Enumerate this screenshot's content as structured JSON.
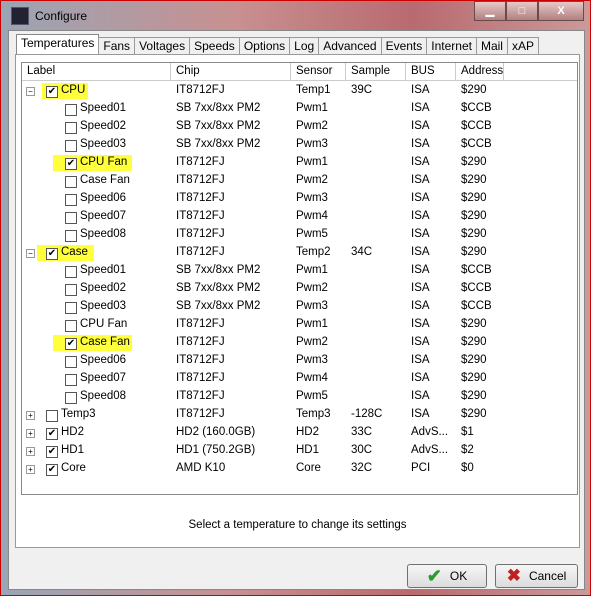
{
  "window": {
    "title": "Configure"
  },
  "tabs": [
    "Temperatures",
    "Fans",
    "Voltages",
    "Speeds",
    "Options",
    "Log",
    "Advanced",
    "Events",
    "Internet",
    "Mail",
    "xAP"
  ],
  "columns": [
    "Label",
    "Chip",
    "Sensor",
    "Sample",
    "BUS",
    "Address"
  ],
  "rows": [
    {
      "level": 0,
      "expander": "-",
      "checked": true,
      "highlight": true,
      "label": "CPU",
      "chip": "IT8712FJ",
      "sensor": "Temp1",
      "sample": "39C",
      "bus": "ISA",
      "address": "$290"
    },
    {
      "level": 1,
      "checked": false,
      "label": "Speed01",
      "chip": "SB 7xx/8xx PM2",
      "sensor": "Pwm1",
      "sample": "",
      "bus": "ISA",
      "address": "$CCB"
    },
    {
      "level": 1,
      "checked": false,
      "label": "Speed02",
      "chip": "SB 7xx/8xx PM2",
      "sensor": "Pwm2",
      "sample": "",
      "bus": "ISA",
      "address": "$CCB"
    },
    {
      "level": 1,
      "checked": false,
      "label": "Speed03",
      "chip": "SB 7xx/8xx PM2",
      "sensor": "Pwm3",
      "sample": "",
      "bus": "ISA",
      "address": "$CCB"
    },
    {
      "level": 1,
      "checked": true,
      "highlight": true,
      "label": "CPU Fan",
      "chip": "IT8712FJ",
      "sensor": "Pwm1",
      "sample": "",
      "bus": "ISA",
      "address": "$290"
    },
    {
      "level": 1,
      "checked": false,
      "label": "Case Fan",
      "chip": "IT8712FJ",
      "sensor": "Pwm2",
      "sample": "",
      "bus": "ISA",
      "address": "$290"
    },
    {
      "level": 1,
      "checked": false,
      "label": "Speed06",
      "chip": "IT8712FJ",
      "sensor": "Pwm3",
      "sample": "",
      "bus": "ISA",
      "address": "$290"
    },
    {
      "level": 1,
      "checked": false,
      "label": "Speed07",
      "chip": "IT8712FJ",
      "sensor": "Pwm4",
      "sample": "",
      "bus": "ISA",
      "address": "$290"
    },
    {
      "level": 1,
      "checked": false,
      "label": "Speed08",
      "chip": "IT8712FJ",
      "sensor": "Pwm5",
      "sample": "",
      "bus": "ISA",
      "address": "$290"
    },
    {
      "level": 0,
      "expander": "-",
      "checked": true,
      "highlight": true,
      "label": "Case",
      "chip": "IT8712FJ",
      "sensor": "Temp2",
      "sample": "34C",
      "bus": "ISA",
      "address": "$290"
    },
    {
      "level": 1,
      "checked": false,
      "label": "Speed01",
      "chip": "SB 7xx/8xx PM2",
      "sensor": "Pwm1",
      "sample": "",
      "bus": "ISA",
      "address": "$CCB"
    },
    {
      "level": 1,
      "checked": false,
      "label": "Speed02",
      "chip": "SB 7xx/8xx PM2",
      "sensor": "Pwm2",
      "sample": "",
      "bus": "ISA",
      "address": "$CCB"
    },
    {
      "level": 1,
      "checked": false,
      "label": "Speed03",
      "chip": "SB 7xx/8xx PM2",
      "sensor": "Pwm3",
      "sample": "",
      "bus": "ISA",
      "address": "$CCB"
    },
    {
      "level": 1,
      "checked": false,
      "label": "CPU Fan",
      "chip": "IT8712FJ",
      "sensor": "Pwm1",
      "sample": "",
      "bus": "ISA",
      "address": "$290"
    },
    {
      "level": 1,
      "checked": true,
      "highlight": true,
      "label": "Case Fan",
      "chip": "IT8712FJ",
      "sensor": "Pwm2",
      "sample": "",
      "bus": "ISA",
      "address": "$290"
    },
    {
      "level": 1,
      "checked": false,
      "label": "Speed06",
      "chip": "IT8712FJ",
      "sensor": "Pwm3",
      "sample": "",
      "bus": "ISA",
      "address": "$290"
    },
    {
      "level": 1,
      "checked": false,
      "label": "Speed07",
      "chip": "IT8712FJ",
      "sensor": "Pwm4",
      "sample": "",
      "bus": "ISA",
      "address": "$290"
    },
    {
      "level": 1,
      "checked": false,
      "label": "Speed08",
      "chip": "IT8712FJ",
      "sensor": "Pwm5",
      "sample": "",
      "bus": "ISA",
      "address": "$290"
    },
    {
      "level": 0,
      "expander": "+",
      "checked": false,
      "label": "Temp3",
      "chip": "IT8712FJ",
      "sensor": "Temp3",
      "sample": "-128C",
      "bus": "ISA",
      "address": "$290"
    },
    {
      "level": 0,
      "expander": "+",
      "checked": true,
      "label": "HD2",
      "chip": "HD2 (160.0GB)",
      "sensor": "HD2",
      "sample": "33C",
      "bus": "AdvS...",
      "address": "$1"
    },
    {
      "level": 0,
      "expander": "+",
      "checked": true,
      "label": "HD1",
      "chip": "HD1 (750.2GB)",
      "sensor": "HD1",
      "sample": "30C",
      "bus": "AdvS...",
      "address": "$2"
    },
    {
      "level": 0,
      "expander": "+",
      "checked": true,
      "label": "Core",
      "chip": "AMD K10",
      "sensor": "Core",
      "sample": "32C",
      "bus": "PCI",
      "address": "$0"
    }
  ],
  "status": "Select a temperature to change its settings",
  "buttons": {
    "ok": "OK",
    "cancel": "Cancel"
  },
  "colors": {
    "highlight": "#ffff3c",
    "ok_icon": "#2a9a2a",
    "cancel_icon": "#c02020"
  }
}
